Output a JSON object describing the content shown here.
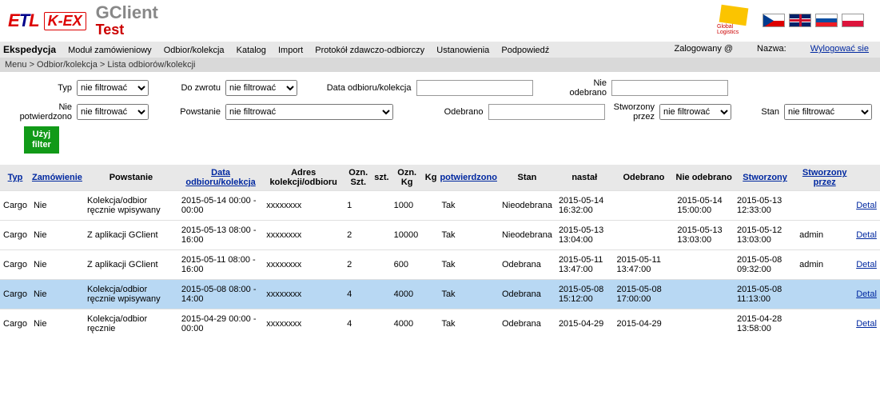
{
  "app": {
    "brand1": "ETL",
    "brand2": "K-EX",
    "title1": "GClient",
    "title2": "Test",
    "geis": "Global Logistics"
  },
  "menu": {
    "items": [
      "Ekspedycja",
      "Moduł zamówieniowy",
      "Odbior/kolekcja",
      "Katalog",
      "Import",
      "Protokół zdawczo-odbiorczy",
      "Ustanowienia",
      "Podpowiedź"
    ],
    "logged": "Zalogowany @",
    "name": "Nazwa:",
    "logout": "Wylogować sie"
  },
  "breadcrumb": "Menu > Odbior/kolekcja > Lista odbiorów/kolekcji",
  "filters": {
    "typ": "Typ",
    "typ_val": "nie filtrować",
    "dozw": "Do zwrotu",
    "dozw_val": "nie filtrować",
    "data": "Data odbioru/kolekcja",
    "nieod": "Nie odebrano",
    "niep": "Nie potwierdzono",
    "niep_val": "nie filtrować",
    "pow": "Powstanie",
    "pow_val": "nie filtrować",
    "odeb": "Odebrano",
    "stw": "Stworzony przez",
    "stw_val": "nie filtrować",
    "stan": "Stan",
    "stan_val": "nie filtrować",
    "btn1": "Użyj",
    "btn2": "filter"
  },
  "th": {
    "typ": "Typ",
    "zam": "Zamówienie",
    "pow": "Powstanie",
    "data": "Data odbioru/kolekcja",
    "adres": "Adres kolekcji/odbioru",
    "ozns": "Ozn. Szt.",
    "szt": "szt.",
    "oznk": "Ozn. Kg",
    "kg": "Kg",
    "potw": "potwierdzono",
    "stan": "Stan",
    "nast": "nastał",
    "odeb": "Odebrano",
    "nieod": "Nie odebrano",
    "stwo": "Stworzony",
    "stwp": "Stworzony przez",
    "detal": "Detal"
  },
  "rows": [
    {
      "typ": "Cargo",
      "zam": "Nie",
      "pow": "Kolekcja/odbior ręcznie wpisywany",
      "data": "2015-05-14 00:00 - 00:00",
      "adres": "xxxxxxxx",
      "ozns": "1",
      "szt": "",
      "oznk": "1000",
      "kg": "",
      "potw": "Tak",
      "stan": "Nieodebrana",
      "nast": "2015-05-14 16:32:00",
      "odeb": "",
      "nieod": "2015-05-14 15:00:00",
      "stwo": "2015-05-13 12:33:00",
      "stwp": ""
    },
    {
      "typ": "Cargo",
      "zam": "Nie",
      "pow": "Z aplikacji GClient",
      "data": "2015-05-13 08:00 - 16:00",
      "adres": "xxxxxxxx",
      "ozns": "2",
      "szt": "",
      "oznk": "10000",
      "kg": "",
      "potw": "Tak",
      "stan": "Nieodebrana",
      "nast": "2015-05-13 13:04:00",
      "odeb": "",
      "nieod": "2015-05-13 13:03:00",
      "stwo": "2015-05-12 13:03:00",
      "stwp": "admin"
    },
    {
      "typ": "Cargo",
      "zam": "Nie",
      "pow": "Z aplikacji GClient",
      "data": "2015-05-11 08:00 - 16:00",
      "adres": "xxxxxxxx",
      "ozns": "2",
      "szt": "",
      "oznk": "600",
      "kg": "",
      "potw": "Tak",
      "stan": "Odebrana",
      "nast": "2015-05-11 13:47:00",
      "odeb": "2015-05-11 13:47:00",
      "nieod": "",
      "stwo": "2015-05-08 09:32:00",
      "stwp": "admin"
    },
    {
      "typ": "Cargo",
      "zam": "Nie",
      "pow": "Kolekcja/odbior ręcznie wpisywany",
      "data": "2015-05-08 08:00 - 14:00",
      "adres": "xxxxxxxx",
      "ozns": "4",
      "szt": "",
      "oznk": "4000",
      "kg": "",
      "potw": "Tak",
      "stan": "Odebrana",
      "nast": "2015-05-08 15:12:00",
      "odeb": "2015-05-08 17:00:00",
      "nieod": "",
      "stwo": "2015-05-08 11:13:00",
      "stwp": "",
      "sel": true
    },
    {
      "typ": "Cargo",
      "zam": "Nie",
      "pow": "Kolekcja/odbior ręcznie",
      "data": "2015-04-29 00:00 - 00:00",
      "adres": "xxxxxxxx",
      "ozns": "4",
      "szt": "",
      "oznk": "4000",
      "kg": "",
      "potw": "Tak",
      "stan": "Odebrana",
      "nast": "2015-04-29",
      "odeb": "2015-04-29",
      "nieod": "",
      "stwo": "2015-04-28 13:58:00",
      "stwp": ""
    }
  ]
}
